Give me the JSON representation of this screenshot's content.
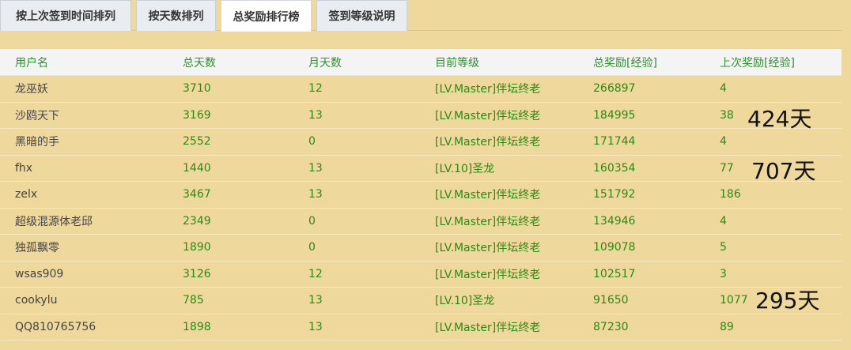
{
  "tabs": [
    {
      "label": "按上次签到时间排列",
      "active": false
    },
    {
      "label": "按天数排列",
      "active": false
    },
    {
      "label": "总奖励排行榜",
      "active": true
    },
    {
      "label": "签到等级说明",
      "active": false
    }
  ],
  "table": {
    "headers": [
      "用户名",
      "总天数",
      "月天数",
      "目前等级",
      "总奖励[经验]",
      "上次奖励[经验]"
    ],
    "rows": [
      [
        "龙巫妖",
        "3710",
        "12",
        "[LV.Master]伴坛终老",
        "266897",
        "4"
      ],
      [
        "沙鸥天下",
        "3169",
        "13",
        "[LV.Master]伴坛终老",
        "184995",
        "38"
      ],
      [
        "黑暗的手",
        "2552",
        "0",
        "[LV.Master]伴坛终老",
        "171744",
        "4"
      ],
      [
        "fhx",
        "1440",
        "13",
        "[LV.10]圣龙",
        "160354",
        "77"
      ],
      [
        "zelx",
        "3467",
        "13",
        "[LV.Master]伴坛终老",
        "151792",
        "186"
      ],
      [
        "超级混源体老邱",
        "2349",
        "0",
        "[LV.Master]伴坛终老",
        "134946",
        "4"
      ],
      [
        "独孤飘零",
        "1890",
        "0",
        "[LV.Master]伴坛终老",
        "109078",
        "5"
      ],
      [
        "wsas909",
        "3126",
        "12",
        "[LV.Master]伴坛终老",
        "102517",
        "3"
      ],
      [
        "cookylu",
        "785",
        "13",
        "[LV.10]圣龙",
        "91650",
        "1077"
      ],
      [
        "QQ810765756",
        "1898",
        "13",
        "[LV.Master]伴坛终老",
        "87230",
        "89"
      ]
    ]
  },
  "annotations": [
    "424天",
    "707天",
    "295天"
  ],
  "colors": {
    "background": "#eed89c",
    "header_text": "#2f8f2f",
    "cell_text": "#2b8a14"
  }
}
